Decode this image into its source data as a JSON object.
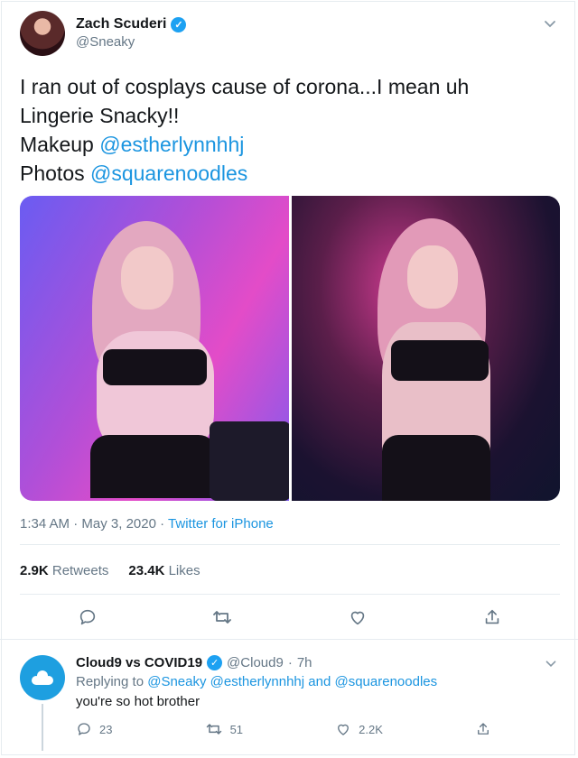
{
  "tweet": {
    "display_name": "Zach Scuderi",
    "handle": "@Sneaky",
    "text_line1": "I ran out of cosplays cause of corona...I mean uh",
    "text_line2": "Lingerie Snacky!!",
    "makeup_label": "Makeup",
    "makeup_link": "@estherlynnhhj",
    "photos_label": "Photos",
    "photos_link": "@squarenoodles",
    "time": "1:34 AM",
    "sep1": "·",
    "date": "May 3, 2020",
    "sep2": "·",
    "source": "Twitter for iPhone",
    "retweets_count": "2.9K",
    "retweets_label": "Retweets",
    "likes_count": "23.4K",
    "likes_label": "Likes",
    "icons": [
      "reply-icon",
      "retweet-icon",
      "like-icon",
      "share-icon"
    ],
    "colors": {
      "link": "#1b95e0",
      "verified": "#1da1f2",
      "muted": "#657786"
    }
  },
  "reply": {
    "display_name": "Cloud9 vs COVID19",
    "handle": "@Cloud9",
    "sep": "·",
    "time": "7h",
    "replying_prefix": "Replying to",
    "replying_1": "@Sneaky",
    "replying_2": "@estherlynnhhj",
    "replying_and": "and",
    "replying_3": "@squarenoodles",
    "text": "you're so hot brother",
    "reply_count": "23",
    "retweet_count": "51",
    "like_count": "2.2K"
  }
}
